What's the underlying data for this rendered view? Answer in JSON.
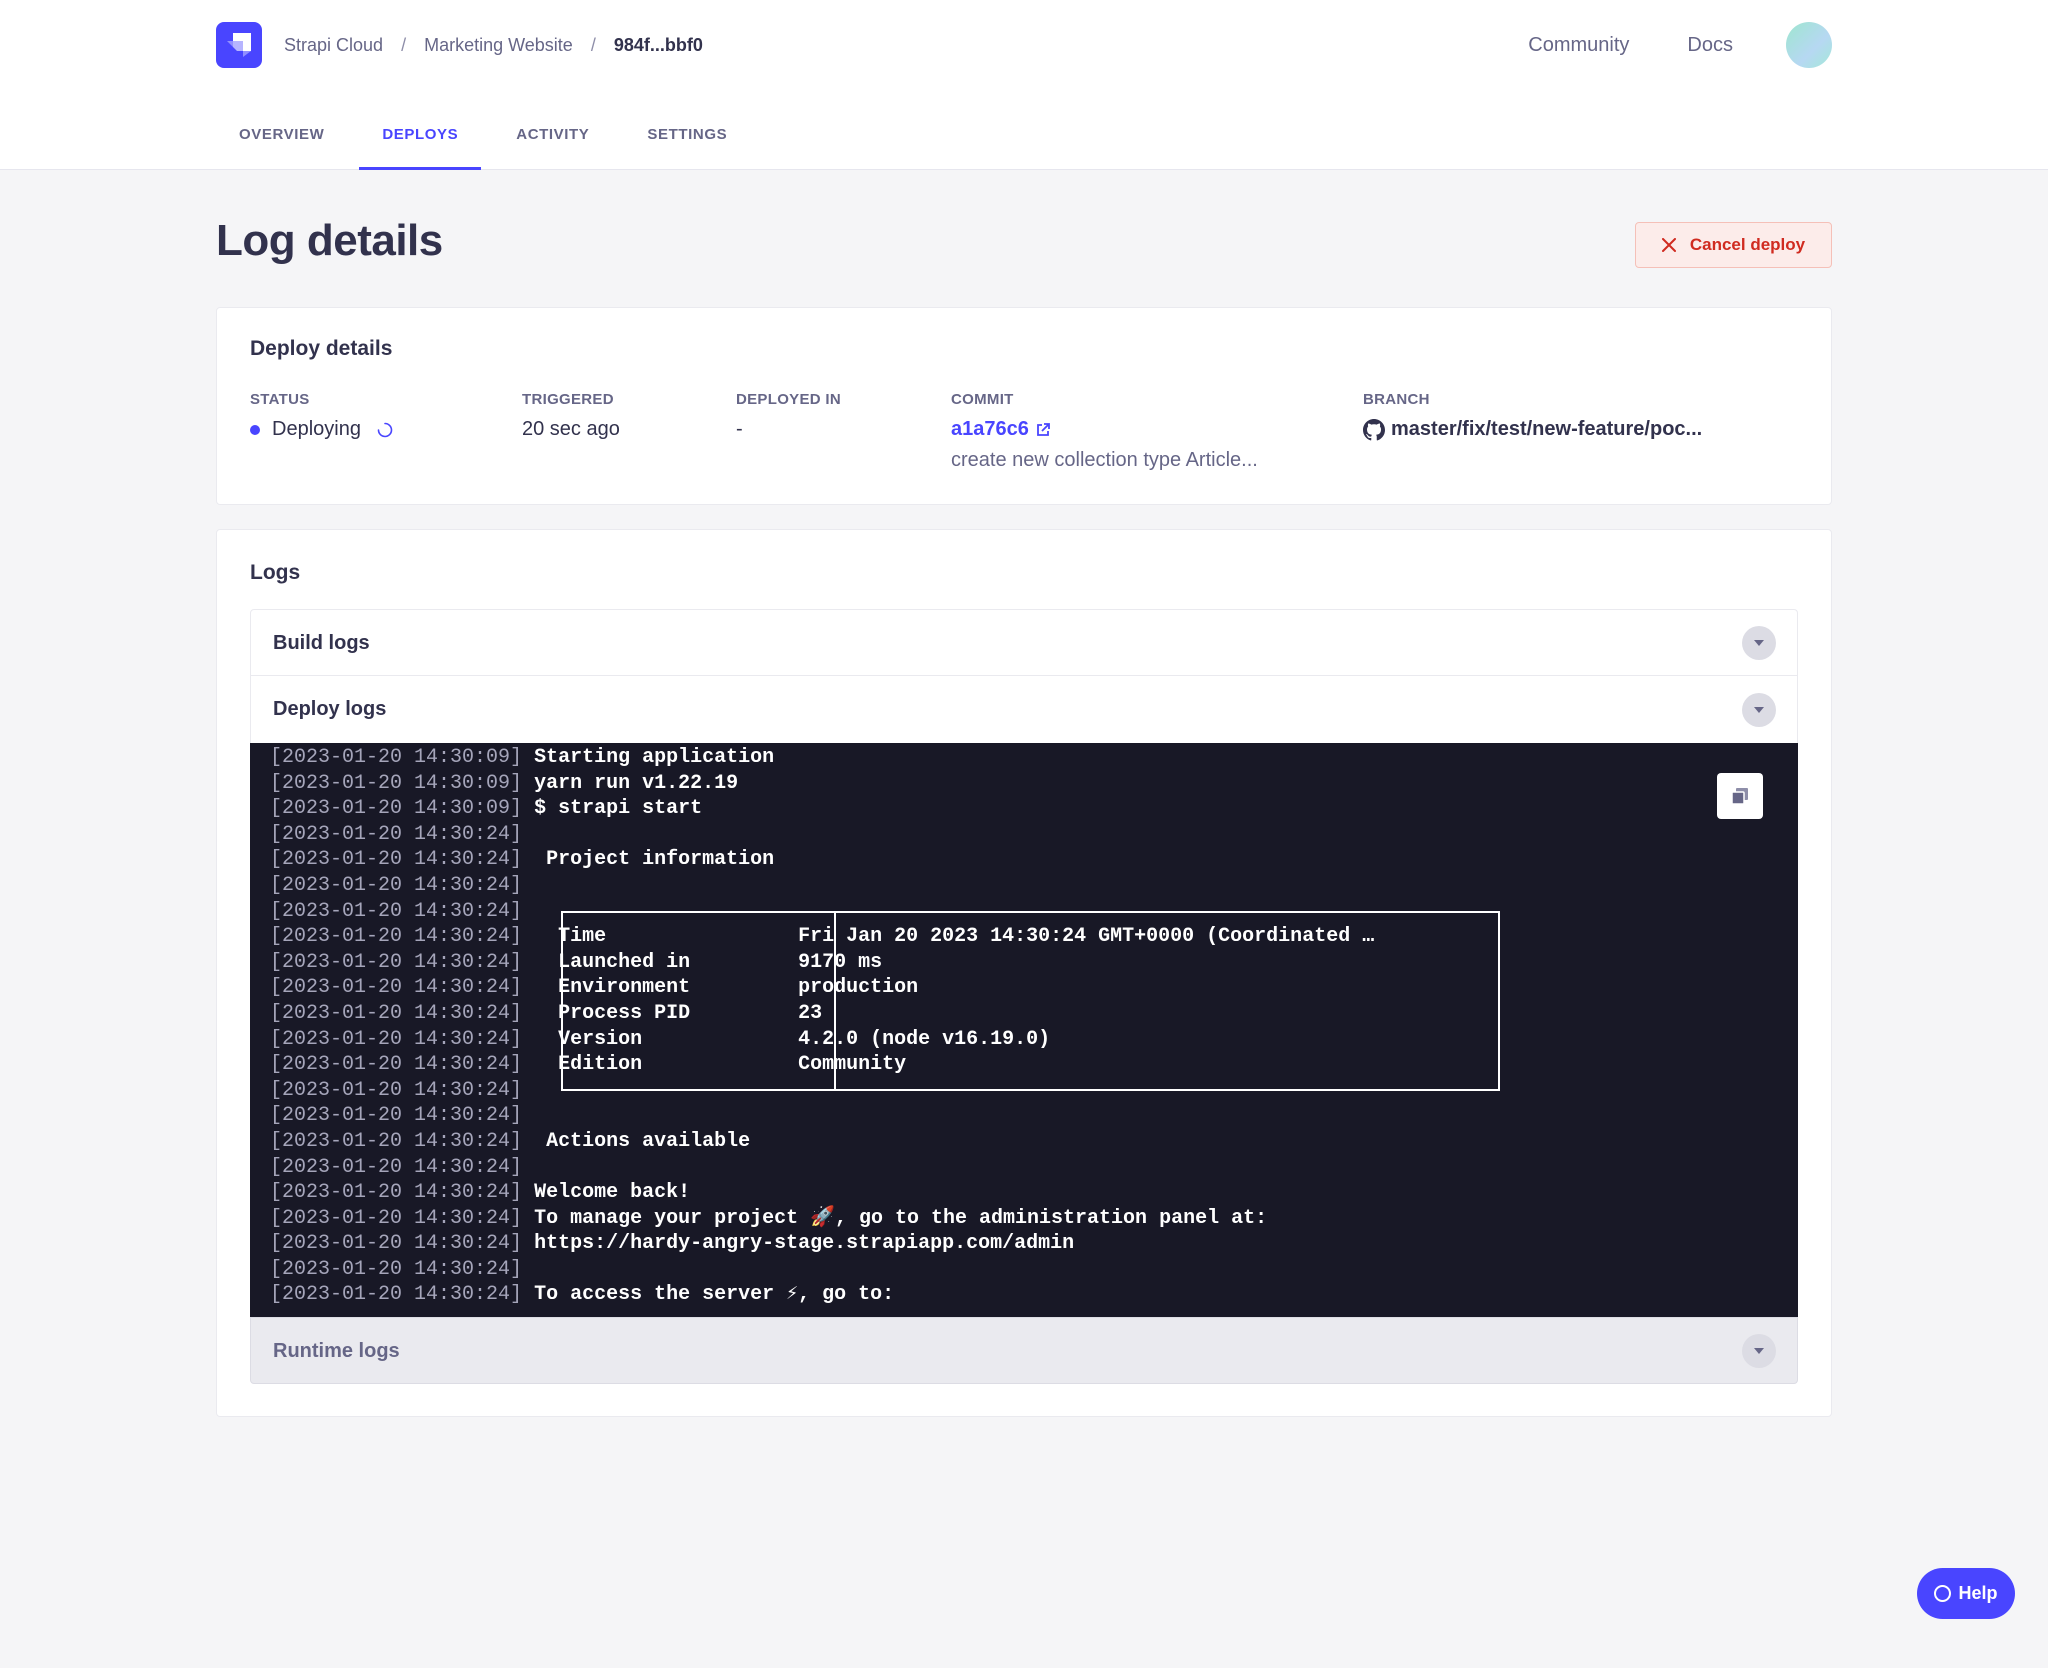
{
  "breadcrumb": {
    "items": [
      "Strapi Cloud",
      "Marketing Website"
    ],
    "current": "984f...bbf0",
    "separator": "/"
  },
  "toplinks": {
    "community": "Community",
    "docs": "Docs"
  },
  "tabs": [
    "OVERVIEW",
    "DEPLOYS",
    "ACTIVITY",
    "SETTINGS"
  ],
  "active_tab": "DEPLOYS",
  "page": {
    "title": "Log details",
    "cancel_label": "Cancel deploy"
  },
  "deploy_details": {
    "title": "Deploy details",
    "status_label": "STATUS",
    "status_value": "Deploying",
    "triggered_label": "TRIGGERED",
    "triggered_value": "20 sec ago",
    "deployed_in_label": "DEPLOYED IN",
    "deployed_in_value": "-",
    "commit_label": "COMMIT",
    "commit_hash": "a1a76c6",
    "commit_message": "create new collection type Article...",
    "branch_label": "BRANCH",
    "branch_value": "master/fix/test/new-feature/poc..."
  },
  "logs": {
    "title": "Logs",
    "build_label": "Build logs",
    "deploy_label": "Deploy logs",
    "runtime_label": "Runtime logs",
    "lines": [
      {
        "ts": "[2023-01-20 14:30:09]",
        "msg": "Starting application"
      },
      {
        "ts": "[2023-01-20 14:30:09]",
        "msg": "yarn run v1.22.19"
      },
      {
        "ts": "[2023-01-20 14:30:09]",
        "msg": "$ strapi start"
      },
      {
        "ts": "[2023-01-20 14:30:24]",
        "msg": ""
      },
      {
        "ts": "[2023-01-20 14:30:24]",
        "msg": " Project information"
      },
      {
        "ts": "[2023-01-20 14:30:24]",
        "msg": ""
      },
      {
        "ts": "[2023-01-20 14:30:24]",
        "msg": ""
      },
      {
        "ts": "[2023-01-20 14:30:24]",
        "msg": "  Time                Fri Jan 20 2023 14:30:24 GMT+0000 (Coordinated …"
      },
      {
        "ts": "[2023-01-20 14:30:24]",
        "msg": "  Launched in         9170 ms"
      },
      {
        "ts": "[2023-01-20 14:30:24]",
        "msg": "  Environment         production"
      },
      {
        "ts": "[2023-01-20 14:30:24]",
        "msg": "  Process PID         23"
      },
      {
        "ts": "[2023-01-20 14:30:24]",
        "msg": "  Version             4.2.0 (node v16.19.0)"
      },
      {
        "ts": "[2023-01-20 14:30:24]",
        "msg": "  Edition             Community"
      },
      {
        "ts": "[2023-01-20 14:30:24]",
        "msg": ""
      },
      {
        "ts": "[2023-01-20 14:30:24]",
        "msg": ""
      },
      {
        "ts": "[2023-01-20 14:30:24]",
        "msg": " Actions available"
      },
      {
        "ts": "[2023-01-20 14:30:24]",
        "msg": ""
      },
      {
        "ts": "[2023-01-20 14:30:24]",
        "msg": "Welcome back!"
      },
      {
        "ts": "[2023-01-20 14:30:24]",
        "msg": "To manage your project 🚀, go to the administration panel at:"
      },
      {
        "ts": "[2023-01-20 14:30:24]",
        "msg": "https://hardy-angry-stage.strapiapp.com/admin"
      },
      {
        "ts": "[2023-01-20 14:30:24]",
        "msg": ""
      },
      {
        "ts": "[2023-01-20 14:30:24]",
        "msg": "To access the server ⚡, go to:"
      }
    ]
  },
  "help_label": "Help",
  "colors": {
    "accent": "#4945ff",
    "danger": "#d02b20",
    "terminal_bg": "#181826"
  }
}
